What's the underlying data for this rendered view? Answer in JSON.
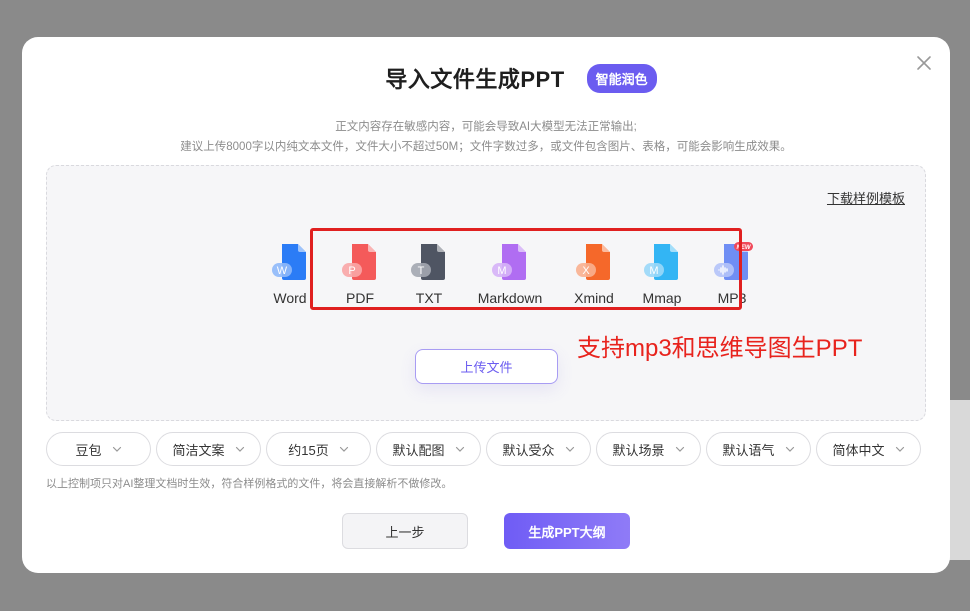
{
  "dialog": {
    "title": "导入文件生成PPT",
    "badge": "智能润色",
    "notice_line1": "正文内容存在敏感内容，可能会导致AI大模型无法正常输出;",
    "notice_line2": "建议上传8000字以内纯文本文件，文件大小不超过50M；文件字数过多，或文件包含图片、表格，可能会影响生成效果。"
  },
  "dropzone": {
    "download_link": "下载样例模板",
    "file_types": [
      {
        "label": "Word",
        "letter": "W",
        "color": "#2b7cf6",
        "light": "#8fb9f9",
        "icon": "word-file-icon"
      },
      {
        "label": "PDF",
        "letter": "P",
        "color": "#f45a5a",
        "light": "#f9a6a6",
        "icon": "pdf-file-icon"
      },
      {
        "label": "TXT",
        "letter": "T",
        "color": "#4f5563",
        "light": "#a3a7b0",
        "icon": "txt-file-icon"
      },
      {
        "label": "Markdown",
        "letter": "M",
        "color": "#b06df2",
        "light": "#d6b2f7",
        "icon": "markdown-file-icon"
      },
      {
        "label": "Xmind",
        "letter": "X",
        "color": "#f5682a",
        "light": "#f9b08f",
        "icon": "xmind-file-icon"
      },
      {
        "label": "Mmap",
        "letter": "M",
        "color": "#33b5f4",
        "light": "#9ad8f8",
        "icon": "mmap-file-icon"
      },
      {
        "label": "MP3",
        "letter": "",
        "color": "#6f8ef4",
        "light": "#b4c3f8",
        "icon": "mp3-file-icon",
        "new_badge": "NEW"
      }
    ],
    "upload_button": "上传文件"
  },
  "annotation": "支持mp3和思维导图生PPT",
  "options": [
    {
      "label": "豆包"
    },
    {
      "label": "简洁文案"
    },
    {
      "label": "约15页"
    },
    {
      "label": "默认配图"
    },
    {
      "label": "默认受众"
    },
    {
      "label": "默认场景"
    },
    {
      "label": "默认语气"
    },
    {
      "label": "简体中文"
    }
  ],
  "hint": "以上控制项只对AI整理文档时生效，符合样例格式的文件，将会直接解析不做修改。",
  "footer": {
    "prev": "上一步",
    "next": "生成PPT大纲"
  },
  "colors": {
    "accent": "#6b5cf0",
    "annotation_red": "#e8231d"
  }
}
